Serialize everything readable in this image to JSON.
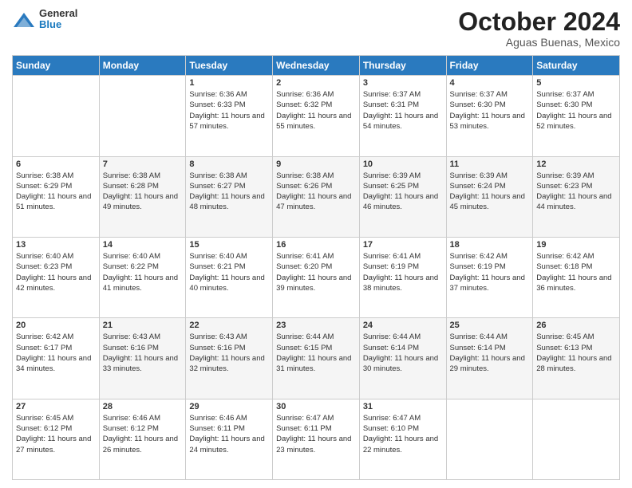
{
  "header": {
    "logo_general": "General",
    "logo_blue": "Blue",
    "month_title": "October 2024",
    "location": "Aguas Buenas, Mexico"
  },
  "weekdays": [
    "Sunday",
    "Monday",
    "Tuesday",
    "Wednesday",
    "Thursday",
    "Friday",
    "Saturday"
  ],
  "weeks": [
    [
      {
        "day": "",
        "sunrise": "",
        "sunset": "",
        "daylight": ""
      },
      {
        "day": "",
        "sunrise": "",
        "sunset": "",
        "daylight": ""
      },
      {
        "day": "1",
        "sunrise": "Sunrise: 6:36 AM",
        "sunset": "Sunset: 6:33 PM",
        "daylight": "Daylight: 11 hours and 57 minutes."
      },
      {
        "day": "2",
        "sunrise": "Sunrise: 6:36 AM",
        "sunset": "Sunset: 6:32 PM",
        "daylight": "Daylight: 11 hours and 55 minutes."
      },
      {
        "day": "3",
        "sunrise": "Sunrise: 6:37 AM",
        "sunset": "Sunset: 6:31 PM",
        "daylight": "Daylight: 11 hours and 54 minutes."
      },
      {
        "day": "4",
        "sunrise": "Sunrise: 6:37 AM",
        "sunset": "Sunset: 6:30 PM",
        "daylight": "Daylight: 11 hours and 53 minutes."
      },
      {
        "day": "5",
        "sunrise": "Sunrise: 6:37 AM",
        "sunset": "Sunset: 6:30 PM",
        "daylight": "Daylight: 11 hours and 52 minutes."
      }
    ],
    [
      {
        "day": "6",
        "sunrise": "Sunrise: 6:38 AM",
        "sunset": "Sunset: 6:29 PM",
        "daylight": "Daylight: 11 hours and 51 minutes."
      },
      {
        "day": "7",
        "sunrise": "Sunrise: 6:38 AM",
        "sunset": "Sunset: 6:28 PM",
        "daylight": "Daylight: 11 hours and 49 minutes."
      },
      {
        "day": "8",
        "sunrise": "Sunrise: 6:38 AM",
        "sunset": "Sunset: 6:27 PM",
        "daylight": "Daylight: 11 hours and 48 minutes."
      },
      {
        "day": "9",
        "sunrise": "Sunrise: 6:38 AM",
        "sunset": "Sunset: 6:26 PM",
        "daylight": "Daylight: 11 hours and 47 minutes."
      },
      {
        "day": "10",
        "sunrise": "Sunrise: 6:39 AM",
        "sunset": "Sunset: 6:25 PM",
        "daylight": "Daylight: 11 hours and 46 minutes."
      },
      {
        "day": "11",
        "sunrise": "Sunrise: 6:39 AM",
        "sunset": "Sunset: 6:24 PM",
        "daylight": "Daylight: 11 hours and 45 minutes."
      },
      {
        "day": "12",
        "sunrise": "Sunrise: 6:39 AM",
        "sunset": "Sunset: 6:23 PM",
        "daylight": "Daylight: 11 hours and 44 minutes."
      }
    ],
    [
      {
        "day": "13",
        "sunrise": "Sunrise: 6:40 AM",
        "sunset": "Sunset: 6:23 PM",
        "daylight": "Daylight: 11 hours and 42 minutes."
      },
      {
        "day": "14",
        "sunrise": "Sunrise: 6:40 AM",
        "sunset": "Sunset: 6:22 PM",
        "daylight": "Daylight: 11 hours and 41 minutes."
      },
      {
        "day": "15",
        "sunrise": "Sunrise: 6:40 AM",
        "sunset": "Sunset: 6:21 PM",
        "daylight": "Daylight: 11 hours and 40 minutes."
      },
      {
        "day": "16",
        "sunrise": "Sunrise: 6:41 AM",
        "sunset": "Sunset: 6:20 PM",
        "daylight": "Daylight: 11 hours and 39 minutes."
      },
      {
        "day": "17",
        "sunrise": "Sunrise: 6:41 AM",
        "sunset": "Sunset: 6:19 PM",
        "daylight": "Daylight: 11 hours and 38 minutes."
      },
      {
        "day": "18",
        "sunrise": "Sunrise: 6:42 AM",
        "sunset": "Sunset: 6:19 PM",
        "daylight": "Daylight: 11 hours and 37 minutes."
      },
      {
        "day": "19",
        "sunrise": "Sunrise: 6:42 AM",
        "sunset": "Sunset: 6:18 PM",
        "daylight": "Daylight: 11 hours and 36 minutes."
      }
    ],
    [
      {
        "day": "20",
        "sunrise": "Sunrise: 6:42 AM",
        "sunset": "Sunset: 6:17 PM",
        "daylight": "Daylight: 11 hours and 34 minutes."
      },
      {
        "day": "21",
        "sunrise": "Sunrise: 6:43 AM",
        "sunset": "Sunset: 6:16 PM",
        "daylight": "Daylight: 11 hours and 33 minutes."
      },
      {
        "day": "22",
        "sunrise": "Sunrise: 6:43 AM",
        "sunset": "Sunset: 6:16 PM",
        "daylight": "Daylight: 11 hours and 32 minutes."
      },
      {
        "day": "23",
        "sunrise": "Sunrise: 6:44 AM",
        "sunset": "Sunset: 6:15 PM",
        "daylight": "Daylight: 11 hours and 31 minutes."
      },
      {
        "day": "24",
        "sunrise": "Sunrise: 6:44 AM",
        "sunset": "Sunset: 6:14 PM",
        "daylight": "Daylight: 11 hours and 30 minutes."
      },
      {
        "day": "25",
        "sunrise": "Sunrise: 6:44 AM",
        "sunset": "Sunset: 6:14 PM",
        "daylight": "Daylight: 11 hours and 29 minutes."
      },
      {
        "day": "26",
        "sunrise": "Sunrise: 6:45 AM",
        "sunset": "Sunset: 6:13 PM",
        "daylight": "Daylight: 11 hours and 28 minutes."
      }
    ],
    [
      {
        "day": "27",
        "sunrise": "Sunrise: 6:45 AM",
        "sunset": "Sunset: 6:12 PM",
        "daylight": "Daylight: 11 hours and 27 minutes."
      },
      {
        "day": "28",
        "sunrise": "Sunrise: 6:46 AM",
        "sunset": "Sunset: 6:12 PM",
        "daylight": "Daylight: 11 hours and 26 minutes."
      },
      {
        "day": "29",
        "sunrise": "Sunrise: 6:46 AM",
        "sunset": "Sunset: 6:11 PM",
        "daylight": "Daylight: 11 hours and 24 minutes."
      },
      {
        "day": "30",
        "sunrise": "Sunrise: 6:47 AM",
        "sunset": "Sunset: 6:11 PM",
        "daylight": "Daylight: 11 hours and 23 minutes."
      },
      {
        "day": "31",
        "sunrise": "Sunrise: 6:47 AM",
        "sunset": "Sunset: 6:10 PM",
        "daylight": "Daylight: 11 hours and 22 minutes."
      },
      {
        "day": "",
        "sunrise": "",
        "sunset": "",
        "daylight": ""
      },
      {
        "day": "",
        "sunrise": "",
        "sunset": "",
        "daylight": ""
      }
    ]
  ]
}
